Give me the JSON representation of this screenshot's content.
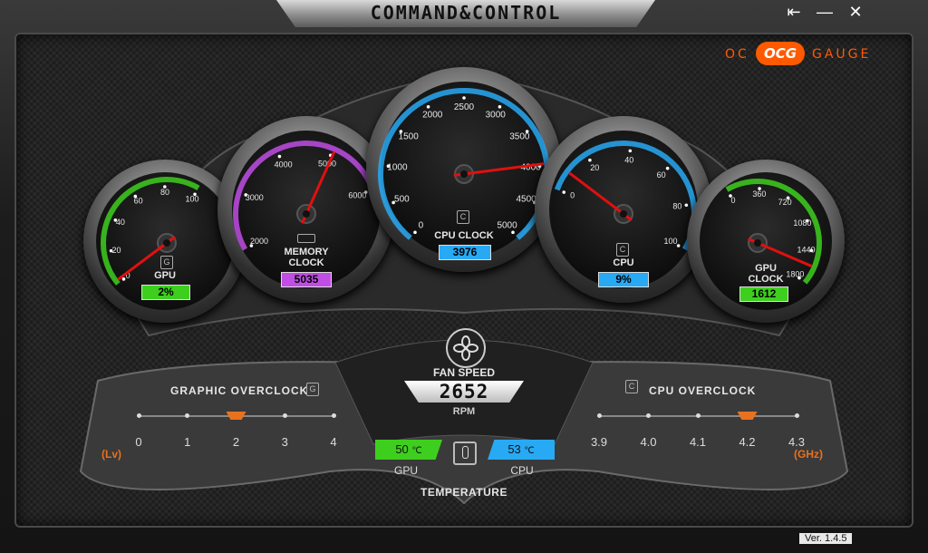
{
  "app": {
    "title": "COMMAND&CONTROL",
    "version": "Ver. 1.4.5",
    "logo": {
      "left": "OC",
      "badge": "OCG",
      "right": "GAUGE"
    }
  },
  "window_buttons": {
    "back": "⇤",
    "minimize": "—",
    "close": "✕"
  },
  "colors": {
    "gpu_green": "#3ecf1e",
    "memory_purple": "#c04ee4",
    "cpu_blue": "#28a9f3",
    "accent_orange": "#e8721d",
    "needle_red": "#e01010"
  },
  "gauges": {
    "gpu": {
      "label": "GPU",
      "readout": "2%",
      "value": 2,
      "ticks": [
        "0",
        "20",
        "40",
        "60",
        "80",
        "100"
      ],
      "min": 0,
      "max": 100
    },
    "memory": {
      "label": "MEMORY\nCLOCK",
      "readout": "5035",
      "value": 5035,
      "ticks": [
        "2000",
        "3000",
        "4000",
        "5000",
        "6000"
      ],
      "min": 2000,
      "max": 6000
    },
    "cpu_clock": {
      "label": "CPU CLOCK",
      "readout": "3976",
      "value": 3976,
      "ticks": [
        "0",
        "500",
        "1000",
        "1500",
        "2000",
        "2500",
        "3000",
        "3500",
        "4000",
        "4500",
        "5000"
      ],
      "min": 0,
      "max": 5000
    },
    "cpu": {
      "label": "CPU",
      "readout": "9%",
      "value": 9,
      "ticks": [
        "0",
        "20",
        "40",
        "60",
        "80",
        "100"
      ],
      "min": 0,
      "max": 100
    },
    "gpu_clock": {
      "label": "GPU\nCLOCK",
      "readout": "1612",
      "value": 1612,
      "ticks": [
        "0",
        "360",
        "720",
        "1080",
        "1440",
        "1800"
      ],
      "min": 0,
      "max": 1800
    }
  },
  "fan": {
    "label": "FAN SPEED",
    "value": "2652",
    "unit": "RPM"
  },
  "graphic_overclock": {
    "label": "GRAPHIC OVERCLOCK",
    "chip": "G",
    "unit": "(Lv)",
    "scale": [
      "0",
      "1",
      "2",
      "3",
      "4"
    ],
    "selected_index": 2
  },
  "cpu_overclock": {
    "label": "CPU OVERCLOCK",
    "chip": "C",
    "unit": "(GHz)",
    "scale": [
      "3.9",
      "4.0",
      "4.1",
      "4.2",
      "4.3"
    ],
    "selected_index": 3
  },
  "temperature": {
    "label": "TEMPERATURE",
    "gpu": {
      "value": "50",
      "unit": "℃",
      "label": "GPU"
    },
    "cpu": {
      "value": "53",
      "unit": "℃",
      "label": "CPU"
    }
  }
}
